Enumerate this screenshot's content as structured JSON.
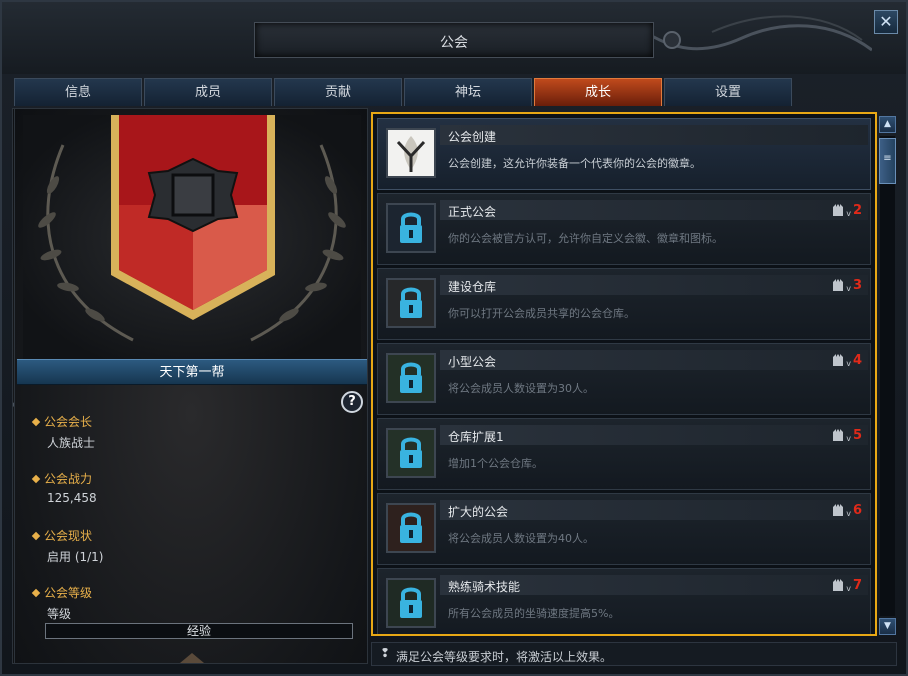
{
  "window": {
    "title": "公会",
    "close_label": "✕"
  },
  "tabs": [
    {
      "label": "信息"
    },
    {
      "label": "成员"
    },
    {
      "label": "贡献"
    },
    {
      "label": "神坛"
    },
    {
      "label": "成长",
      "active": true
    },
    {
      "label": "设置"
    }
  ],
  "guild": {
    "name": "天下第一帮",
    "help_label": "?",
    "info": [
      {
        "label": "公会会长",
        "value": "人族战士"
      },
      {
        "label": "公会战力",
        "value": "125,458"
      },
      {
        "label": "公会现状",
        "value": "启用 (1/1)"
      },
      {
        "label": "公会等级",
        "value": "等级"
      }
    ],
    "exp_label": "经验",
    "colors": {
      "banner_red": "#b01c1c",
      "banner_gold": "#d8b25a"
    }
  },
  "growth_list": [
    {
      "title": "公会创建",
      "desc": "公会创建，这允许你装备一个代表你的公会的徽章。",
      "unlocked": true,
      "level": "",
      "icon": "guild-emblem-icon"
    },
    {
      "title": "正式公会",
      "desc": "你的公会被官方认可，允许你自定义会徽、徽章和图标。",
      "unlocked": false,
      "level": "2",
      "icon": "lock-icon"
    },
    {
      "title": "建设仓库",
      "desc": "你可以打开公会成员共享的公会仓库。",
      "unlocked": false,
      "level": "3",
      "icon": "lock-icon"
    },
    {
      "title": "小型公会",
      "desc": "将公会成员人数设置为30人。",
      "unlocked": false,
      "level": "4",
      "icon": "lock-icon"
    },
    {
      "title": "仓库扩展1",
      "desc": "增加1个公会仓库。",
      "unlocked": false,
      "level": "5",
      "icon": "lock-icon"
    },
    {
      "title": "扩大的公会",
      "desc": "将公会成员人数设置为40人。",
      "unlocked": false,
      "level": "6",
      "icon": "lock-icon"
    },
    {
      "title": "熟练骑术技能",
      "desc": "所有公会成员的坐骑速度提高5%。",
      "unlocked": false,
      "level": "7",
      "icon": "lock-icon"
    }
  ],
  "level_mark": "v",
  "footer": {
    "icon": "info-bulb-icon",
    "text": "满足公会等级要求时，将激活以上效果。"
  },
  "accent_colors": {
    "highlight_border": "#e8a815",
    "active_tab": "#c04a1c",
    "required_level": "#e02a1a",
    "info_label": "#e8b04a"
  }
}
